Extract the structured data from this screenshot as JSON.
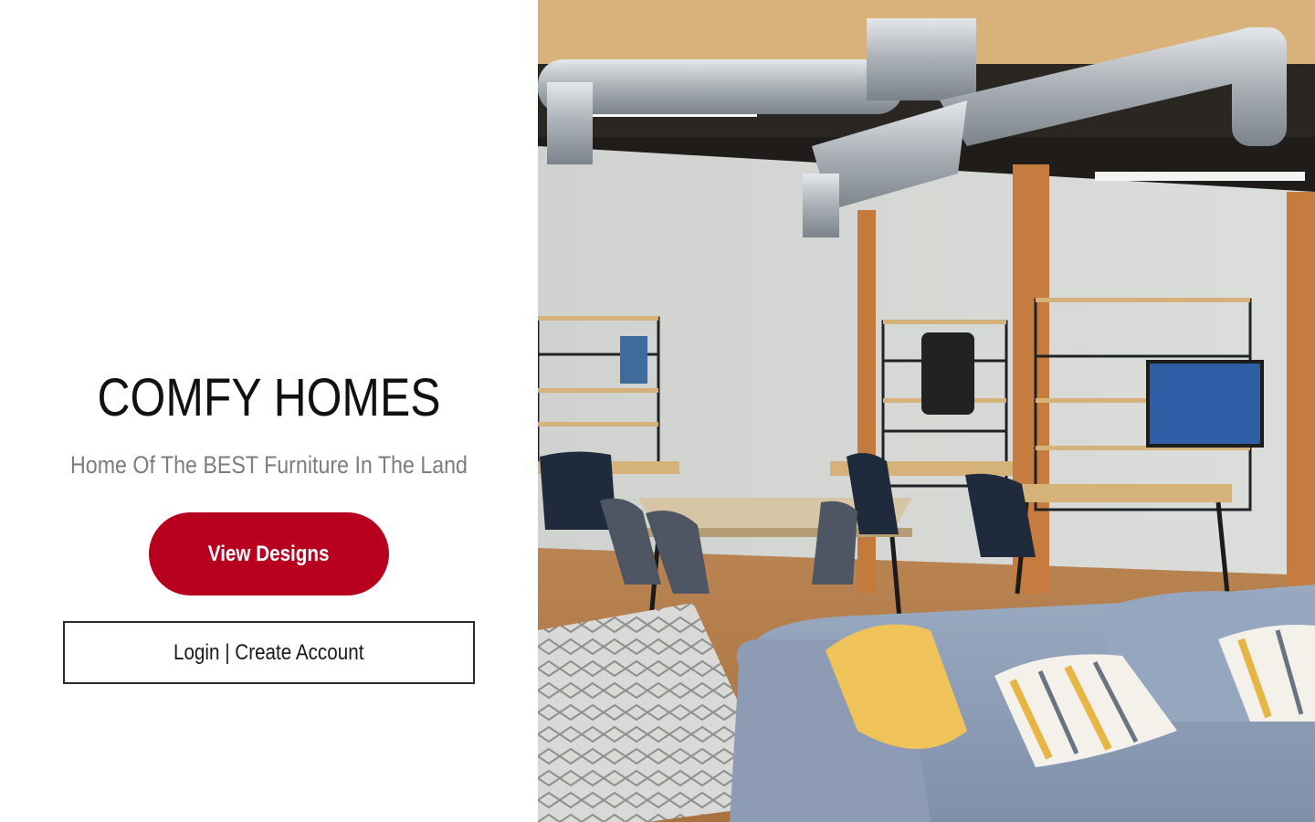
{
  "brand": {
    "title": "COMFY HOMES",
    "tagline": "Home Of The BEST Furniture In The Land"
  },
  "actions": {
    "view_designs_label": "View Designs",
    "login_label": "Login | Create Account"
  },
  "hero": {
    "image_alt": "photo-of-open-loft-showroom"
  },
  "colors": {
    "accent": "#b8001f",
    "title_text": "#111111",
    "tagline_text": "#7d7d7d",
    "button_border": "#2a2a2a"
  }
}
